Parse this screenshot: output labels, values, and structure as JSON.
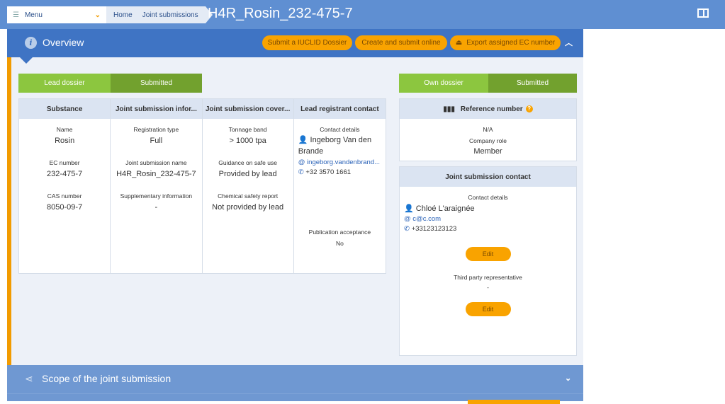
{
  "topbar": {
    "menu": "Menu",
    "breadcrumb": [
      "Home",
      "Joint submissions"
    ],
    "title": "H4R_Rosin_232-475-7"
  },
  "overview": {
    "title": "Overview",
    "buttons": [
      "Submit a IUCLID Dossier",
      "Create and submit online",
      "Export assigned EC number"
    ]
  },
  "lead_status": {
    "label": "Lead dossier",
    "state": "Submitted"
  },
  "own_status": {
    "label": "Own dossier",
    "state": "Submitted"
  },
  "table": {
    "headers": [
      "Substance",
      "Joint submission infor...",
      "Joint submission cover...",
      "Lead registrant contact"
    ],
    "substance": [
      {
        "k": "Name",
        "v": "Rosin"
      },
      {
        "k": "EC number",
        "v": "232-475-7"
      },
      {
        "k": "CAS number",
        "v": "8050-09-7"
      }
    ],
    "info": [
      {
        "k": "Registration type",
        "v": "Full"
      },
      {
        "k": "Joint submission name",
        "v": "H4R_Rosin_232-475-7"
      },
      {
        "k": "Supplementary information",
        "v": "-"
      }
    ],
    "coverage": [
      {
        "k": "Tonnage band",
        "v": "> 1000 tpa"
      },
      {
        "k": "Guidance on safe use",
        "v": "Provided by lead"
      },
      {
        "k": "Chemical safety report",
        "v": "Not provided by lead"
      }
    ],
    "lead": {
      "k": "Contact details",
      "name": "Ingeborg Van den Brande",
      "email": "ingeborg.vandenbrand...",
      "phone": "+32 3570 1661",
      "pub_k": "Publication acceptance",
      "pub_v": "No"
    }
  },
  "reference": {
    "title": "Reference number",
    "value": "N/A",
    "role_k": "Company role",
    "role_v": "Member"
  },
  "js_contact": {
    "title": "Joint submission contact",
    "k": "Contact details",
    "name": "Chloé L'araignée",
    "email": "c@c.com",
    "phone": "+33123123123",
    "edit": "Edit",
    "tpr_k": "Third party representative",
    "tpr_v": "-",
    "edit2": "Edit"
  },
  "scope": {
    "title": "Scope of the joint submission"
  }
}
